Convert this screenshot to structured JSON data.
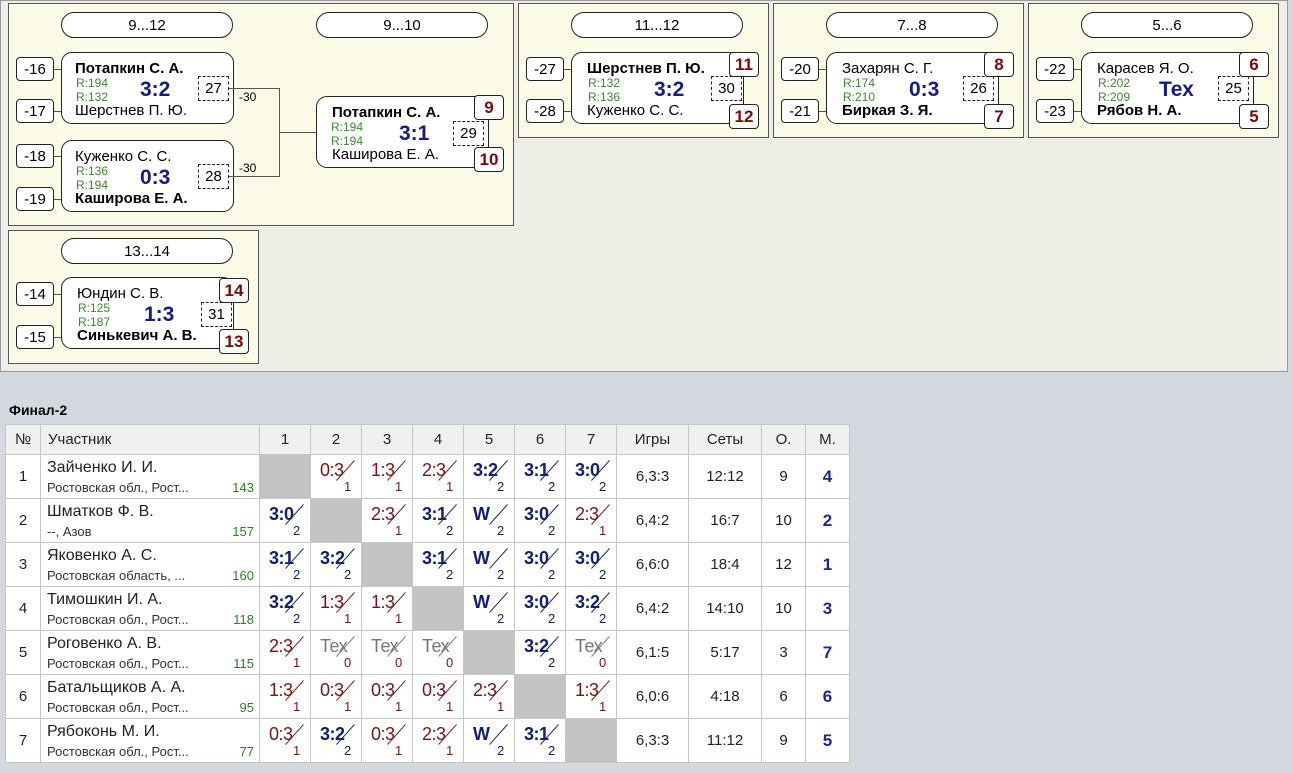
{
  "brackets": {
    "b912": {
      "stage": "9...12",
      "seeds": [
        "-16",
        "-17",
        "-18",
        "-19"
      ],
      "m1": {
        "p1": "Потапкин С. А.",
        "p2": "Шерстнев П. Ю.",
        "r1": "R:194",
        "r2": "R:132",
        "score": "3:2",
        "num": "27",
        "loser": "-30"
      },
      "m2": {
        "p1": "Куженко С. С.",
        "p2": "Каширова Е. А.",
        "r1": "R:136",
        "r2": "R:194",
        "score": "0:3",
        "num": "28",
        "loser": "-30"
      }
    },
    "b910": {
      "stage": "9...10",
      "m": {
        "p1": "Потапкин С. А.",
        "p2": "Каширова Е. А.",
        "r1": "R:194",
        "r2": "R:194",
        "score": "3:1",
        "num": "29",
        "place1": "9",
        "place2": "10"
      }
    },
    "b1112": {
      "stage": "11...12",
      "seeds": [
        "-27",
        "-28"
      ],
      "m": {
        "p1": "Шерстнев П. Ю.",
        "p2": "Куженко С. С.",
        "r1": "R:132",
        "r2": "R:136",
        "score": "3:2",
        "num": "30",
        "place1": "11",
        "place2": "12"
      }
    },
    "b78": {
      "stage": "7...8",
      "seeds": [
        "-20",
        "-21"
      ],
      "m": {
        "p1": "Захарян С. Г.",
        "p2": "Биркая З. Я.",
        "r1": "R:174",
        "r2": "R:210",
        "score": "0:3",
        "num": "26",
        "place1": "8",
        "place2": "7"
      }
    },
    "b56": {
      "stage": "5...6",
      "seeds": [
        "-22",
        "-23"
      ],
      "m": {
        "p1": "Карасев Я. О.",
        "p2": "Рябов Н. А.",
        "r1": "R:202",
        "r2": "R:209",
        "score": "Тех",
        "num": "25",
        "place1": "6",
        "place2": "5"
      }
    },
    "b1314": {
      "stage": "13...14",
      "seeds": [
        "-14",
        "-15"
      ],
      "m": {
        "p1": "Юндин С. В.",
        "p2": "Синькевич А. В.",
        "r1": "R:125",
        "r2": "R:187",
        "score": "1:3",
        "num": "31",
        "place1": "14",
        "place2": "13"
      }
    }
  },
  "group": {
    "title": "Финал-2",
    "headers": [
      "№",
      "Участник",
      "1",
      "2",
      "3",
      "4",
      "5",
      "6",
      "7",
      "Игры",
      "Сеты",
      "О.",
      "М."
    ],
    "rows": [
      {
        "n": "1",
        "name": "Зайченко И. И.",
        "club": "Ростовская обл., Рост...",
        "rating": "143",
        "res": [
          null,
          {
            "s": "0:3",
            "p": "1",
            "k": "los"
          },
          {
            "s": "1:3",
            "p": "1",
            "k": "los"
          },
          {
            "s": "2:3",
            "p": "1",
            "k": "los"
          },
          {
            "s": "3:2",
            "p": "2",
            "k": "win"
          },
          {
            "s": "3:1",
            "p": "2",
            "k": "win"
          },
          {
            "s": "3:0",
            "p": "2",
            "k": "win"
          }
        ],
        "games": "6,3:3",
        "sets": "12:12",
        "pts": "9",
        "place": "4"
      },
      {
        "n": "2",
        "name": "Шматков Ф. В.",
        "club": "--, Азов",
        "rating": "157",
        "res": [
          {
            "s": "3:0",
            "p": "2",
            "k": "win"
          },
          null,
          {
            "s": "2:3",
            "p": "1",
            "k": "los"
          },
          {
            "s": "3:1",
            "p": "2",
            "k": "win"
          },
          {
            "s": "W",
            "p": "2",
            "k": "win"
          },
          {
            "s": "3:0",
            "p": "2",
            "k": "win"
          },
          {
            "s": "2:3",
            "p": "1",
            "k": "los"
          }
        ],
        "games": "6,4:2",
        "sets": "16:7",
        "pts": "10",
        "place": "2"
      },
      {
        "n": "3",
        "name": "Яковенко А. С.",
        "club": "Ростовская область, ...",
        "rating": "160",
        "res": [
          {
            "s": "3:1",
            "p": "2",
            "k": "win"
          },
          {
            "s": "3:2",
            "p": "2",
            "k": "win"
          },
          null,
          {
            "s": "3:1",
            "p": "2",
            "k": "win"
          },
          {
            "s": "W",
            "p": "2",
            "k": "win"
          },
          {
            "s": "3:0",
            "p": "2",
            "k": "win"
          },
          {
            "s": "3:0",
            "p": "2",
            "k": "win"
          }
        ],
        "games": "6,6:0",
        "sets": "18:4",
        "pts": "12",
        "place": "1"
      },
      {
        "n": "4",
        "name": "Тимошкин И. А.",
        "club": "Ростовская обл., Рост...",
        "rating": "118",
        "res": [
          {
            "s": "3:2",
            "p": "2",
            "k": "win"
          },
          {
            "s": "1:3",
            "p": "1",
            "k": "los"
          },
          {
            "s": "1:3",
            "p": "1",
            "k": "los"
          },
          null,
          {
            "s": "W",
            "p": "2",
            "k": "win"
          },
          {
            "s": "3:0",
            "p": "2",
            "k": "win"
          },
          {
            "s": "3:2",
            "p": "2",
            "k": "win"
          }
        ],
        "games": "6,4:2",
        "sets": "14:10",
        "pts": "10",
        "place": "3"
      },
      {
        "n": "5",
        "name": "Роговенко А. В.",
        "club": "Ростовская обл., Рост...",
        "rating": "115",
        "res": [
          {
            "s": "2:3",
            "p": "1",
            "k": "los"
          },
          {
            "s": "Тех",
            "p": "0",
            "k": "tex"
          },
          {
            "s": "Тех",
            "p": "0",
            "k": "tex"
          },
          {
            "s": "Тех",
            "p": "0",
            "k": "tex"
          },
          null,
          {
            "s": "3:2",
            "p": "2",
            "k": "win"
          },
          {
            "s": "Тех",
            "p": "0",
            "k": "tex"
          }
        ],
        "games": "6,1:5",
        "sets": "5:17",
        "pts": "3",
        "place": "7"
      },
      {
        "n": "6",
        "name": "Батальщиков А. А.",
        "club": "Ростовская обл., Рост...",
        "rating": "95",
        "res": [
          {
            "s": "1:3",
            "p": "1",
            "k": "los"
          },
          {
            "s": "0:3",
            "p": "1",
            "k": "los"
          },
          {
            "s": "0:3",
            "p": "1",
            "k": "los"
          },
          {
            "s": "0:3",
            "p": "1",
            "k": "los"
          },
          {
            "s": "2:3",
            "p": "1",
            "k": "los"
          },
          null,
          {
            "s": "1:3",
            "p": "1",
            "k": "los"
          }
        ],
        "games": "6,0:6",
        "sets": "4:18",
        "pts": "6",
        "place": "6"
      },
      {
        "n": "7",
        "name": "Рябоконь М. И.",
        "club": "Ростовская обл., Рост...",
        "rating": "77",
        "res": [
          {
            "s": "0:3",
            "p": "1",
            "k": "los"
          },
          {
            "s": "3:2",
            "p": "2",
            "k": "win"
          },
          {
            "s": "0:3",
            "p": "1",
            "k": "los"
          },
          {
            "s": "2:3",
            "p": "1",
            "k": "los"
          },
          {
            "s": "W",
            "p": "2",
            "k": "win"
          },
          {
            "s": "3:1",
            "p": "2",
            "k": "win"
          },
          null
        ],
        "games": "6,3:3",
        "sets": "11:12",
        "pts": "9",
        "place": "5"
      }
    ]
  }
}
